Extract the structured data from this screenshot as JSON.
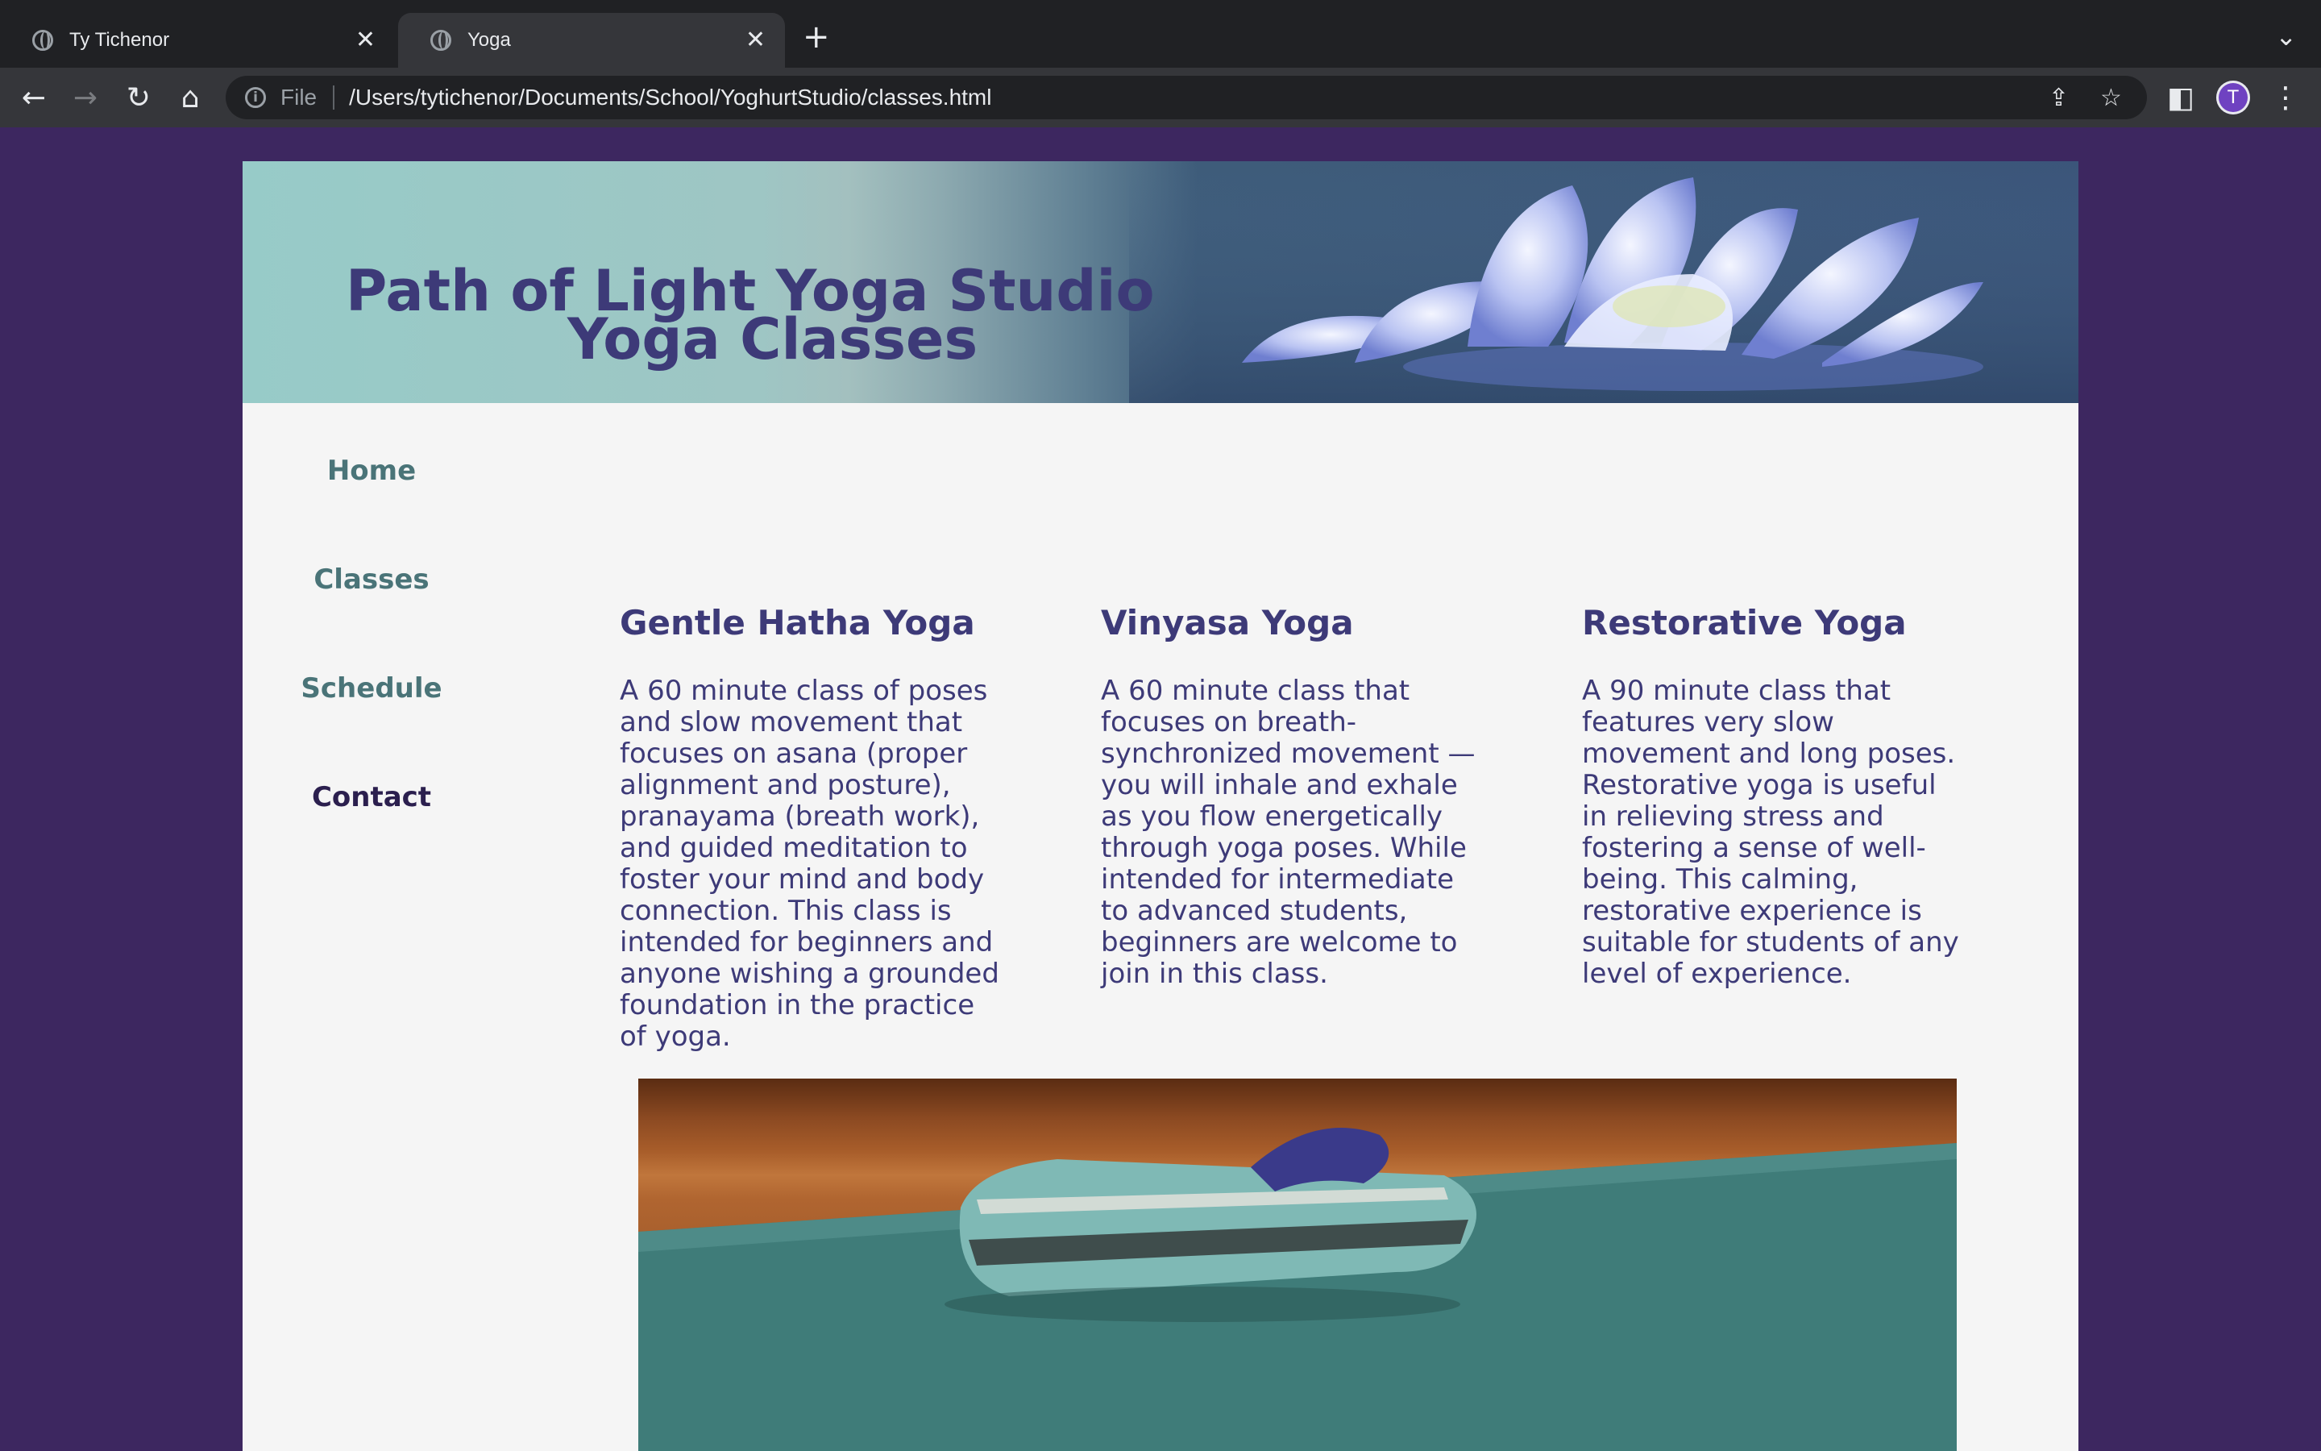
{
  "browser": {
    "tabs": [
      {
        "title": "Ty Tichenor",
        "active": false
      },
      {
        "title": "Yoga",
        "active": true
      }
    ],
    "address": {
      "scheme": "File",
      "url": "/Users/tytichenor/Documents/School/YoghurtStudio/classes.html"
    },
    "profile_initial": "T"
  },
  "site": {
    "title": "Path of Light Yoga Studio",
    "nav": [
      "Home",
      "Classes",
      "Schedule",
      "Contact"
    ]
  },
  "main": {
    "heading": "Yoga Classes",
    "classes": [
      {
        "name": "Gentle Hatha Yoga",
        "description": "A 60 minute class of poses and slow movement that focuses on asana (proper alignment and posture), pranayama (breath work), and guided meditation to foster your mind and body connection. This class is intended for beginners and anyone wishing a grounded foundation in the practice of yoga."
      },
      {
        "name": "Vinyasa Yoga",
        "description": "A 60 minute class that focuses on breath-synchronized movement — you will inhale and exhale as you flow energetically through yoga poses. While intended for intermediate to advanced students, beginners are welcome to join in this class."
      },
      {
        "name": "Restorative Yoga",
        "description": "A 90 minute class that features very slow movement and long poses. Restorative yoga is useful in relieving stress and fostering a sense of well-being. This calming, restorative experience is suitable for students of any level of experience."
      }
    ]
  },
  "colors": {
    "page_background": "#3d2760",
    "content_background": "#f5f5f5",
    "heading": "#3d3a78",
    "nav_link": "#4a7478",
    "nav_visited": "#2b1f4e"
  }
}
